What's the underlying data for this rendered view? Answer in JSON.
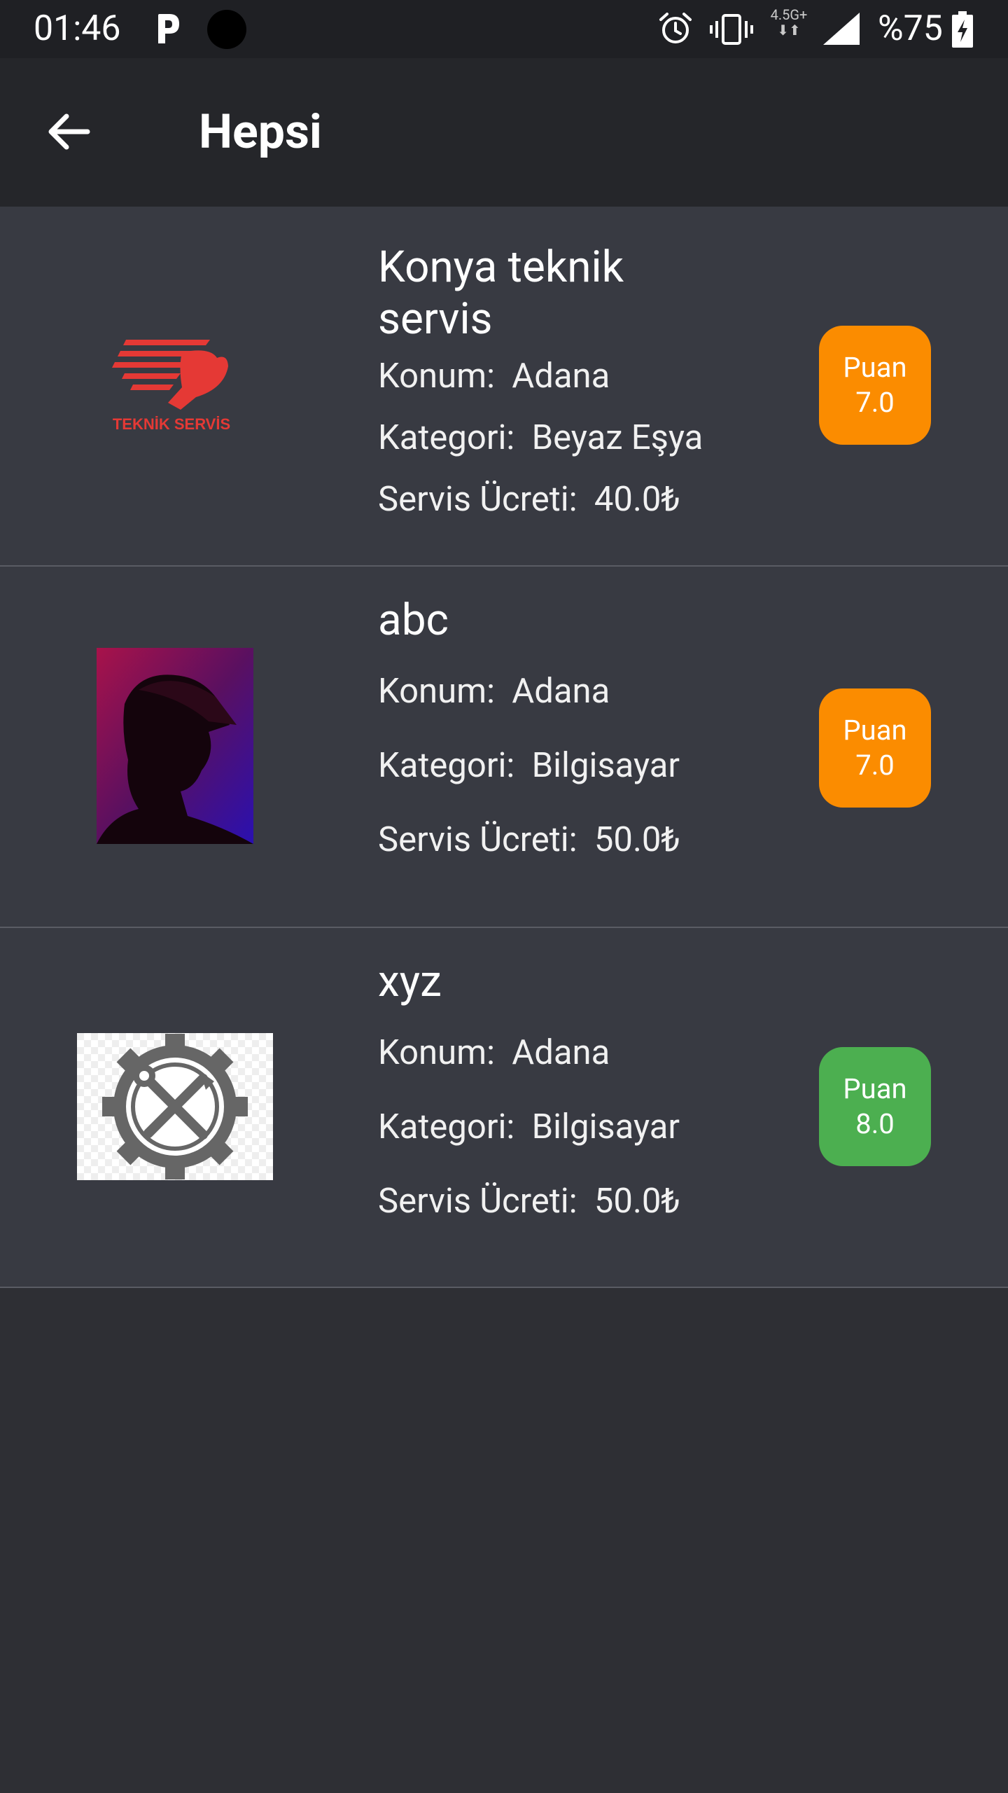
{
  "status_bar": {
    "time": "01:46",
    "network": "4.5G+",
    "battery": "%75",
    "icons": [
      "parking-icon",
      "dot-icon",
      "alarm-icon",
      "vibrate-icon",
      "signal-icon",
      "battery-charging-icon"
    ]
  },
  "app_bar": {
    "title": "Hepsi",
    "back_icon": "arrow-back-icon"
  },
  "colors": {
    "rating_orange": "#fb8c00",
    "rating_green": "#4caf50",
    "card_bg": "#383a42",
    "page_bg": "#2e2f34"
  },
  "services": [
    {
      "title": "Konya teknik servis",
      "title_line1": "Konya teknik",
      "title_line2": "servis",
      "location_label": "Konum:",
      "location": "Adana",
      "category_label": "Kategori:",
      "category": "Beyaz Eşya",
      "fee_label": "Servis Ücreti:",
      "fee": "40.0₺",
      "rating_label": "Puan",
      "rating": "7.0",
      "logo_text": "TEKNİK SERVİS"
    },
    {
      "title": "abc",
      "location_label": "Konum:",
      "location": "Adana",
      "category_label": "Kategori:",
      "category": "Bilgisayar",
      "fee_label": "Servis Ücreti:",
      "fee": "50.0₺",
      "rating_label": "Puan",
      "rating": "7.0"
    },
    {
      "title": "xyz",
      "location_label": "Konum:",
      "location": "Adana",
      "category_label": "Kategori:",
      "category": "Bilgisayar",
      "fee_label": "Servis Ücreti:",
      "fee": "50.0₺",
      "rating_label": "Puan",
      "rating": "8.0"
    }
  ]
}
